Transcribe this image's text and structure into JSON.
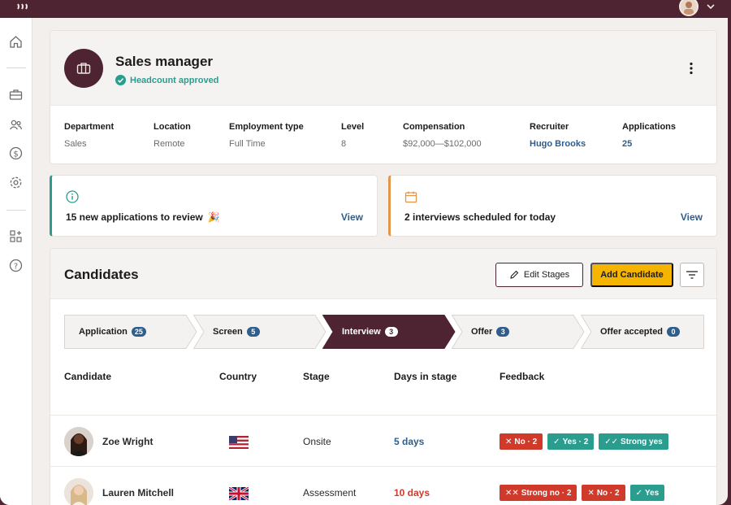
{
  "header": {
    "icons": {
      "logo": "waves-logo-icon",
      "account_chevron": "chevron-down-icon"
    }
  },
  "sidebar": {
    "items": [
      {
        "icon": "home-icon"
      },
      {
        "icon": "briefcase-icon"
      },
      {
        "icon": "people-icon"
      },
      {
        "icon": "dollar-icon"
      },
      {
        "icon": "gear-icon"
      },
      {
        "icon": "apps-add-icon"
      },
      {
        "icon": "help-icon"
      }
    ]
  },
  "job": {
    "title": "Sales manager",
    "status": "Headcount approved",
    "meta": [
      {
        "label": "Department",
        "value": "Sales"
      },
      {
        "label": "Location",
        "value": "Remote"
      },
      {
        "label": "Employment type",
        "value": "Full Time"
      },
      {
        "label": "Level",
        "value": "8"
      },
      {
        "label": "Compensation",
        "value": "$92,000—$102,000"
      },
      {
        "label": "Recruiter",
        "value": "Hugo Brooks"
      },
      {
        "label": "Applications",
        "value": "25"
      }
    ]
  },
  "notices": [
    {
      "text": "15 new applications to review",
      "emoji": "🎉",
      "action": "View",
      "icon": "info-icon"
    },
    {
      "text": "2 interviews scheduled for today",
      "action": "View",
      "icon": "calendar-icon"
    }
  ],
  "candidates": {
    "title": "Candidates",
    "edit_label": "Edit Stages",
    "add_label": "Add Candidate",
    "stages": [
      {
        "label": "Application",
        "count": "25",
        "active": false
      },
      {
        "label": "Screen",
        "count": "5",
        "active": false
      },
      {
        "label": "Interview",
        "count": "3",
        "active": true
      },
      {
        "label": "Offer",
        "count": "3",
        "active": false
      },
      {
        "label": "Offer accepted",
        "count": "0",
        "active": false
      }
    ],
    "columns": [
      "Candidate",
      "Country",
      "Stage",
      "Days in stage",
      "Feedback"
    ],
    "rows": [
      {
        "name": "Zoe Wright",
        "country": "us-flag-icon",
        "stage": "Onsite",
        "days": "5 days",
        "days_color": "#2f5d8c",
        "feedback": [
          {
            "label": "No · 2",
            "kind": "no",
            "mark": "✕"
          },
          {
            "label": "Yes · 2",
            "kind": "yes",
            "mark": "✓"
          },
          {
            "label": "Strong yes",
            "kind": "yes",
            "mark": "✓✓"
          }
        ]
      },
      {
        "name": "Lauren Mitchell",
        "country": "uk-flag-icon",
        "stage": "Assessment",
        "days": "10 days",
        "days_color": "#cf3a2b",
        "feedback": [
          {
            "label": "Strong no · 2",
            "kind": "no",
            "mark": "✕✕"
          },
          {
            "label": "No · 2",
            "kind": "no",
            "mark": "✕"
          },
          {
            "label": "Yes",
            "kind": "yes",
            "mark": "✓"
          }
        ]
      }
    ]
  },
  "colors": {
    "brand": "#4e2332",
    "accent_yellow": "#f4b400",
    "teal": "#2a9d8f",
    "link": "#2f5d8c",
    "danger": "#cf3a2b"
  }
}
